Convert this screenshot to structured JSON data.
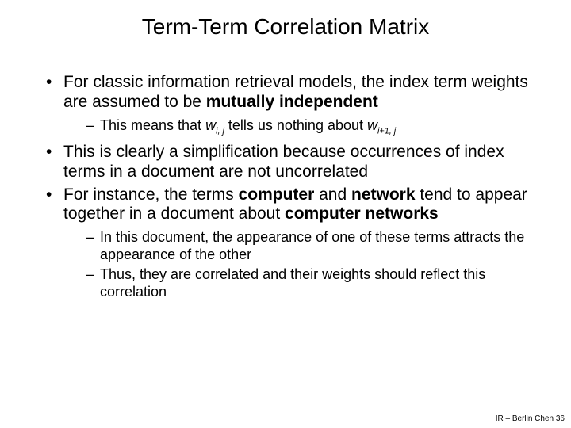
{
  "title": "Term-Term Correlation Matrix",
  "bullets": {
    "b1_pre": "For classic information retrieval models, the index term weights are assumed to be ",
    "b1_bold": "mutually independent",
    "b1_sub1_pre": "This means that ",
    "b1_sub1_w1": "w",
    "b1_sub1_s1": "i, j",
    "b1_sub1_mid": " tells us nothing about ",
    "b1_sub1_w2": "w",
    "b1_sub1_s2": "i+1, j",
    "b2": "This is clearly a simplification because occurrences of index terms in a document are not uncorrelated",
    "b3_pre": "For instance, the terms ",
    "b3_bold1": "computer",
    "b3_mid1": " and ",
    "b3_bold2": "network",
    "b3_mid2": " tend to appear together in a document about ",
    "b3_bold3": "computer networks",
    "b3_sub1": "In this document, the appearance of one of these terms attracts the appearance of the other",
    "b3_sub2": "Thus, they are correlated and their weights should reflect this correlation"
  },
  "footer": "IR – Berlin Chen 36"
}
